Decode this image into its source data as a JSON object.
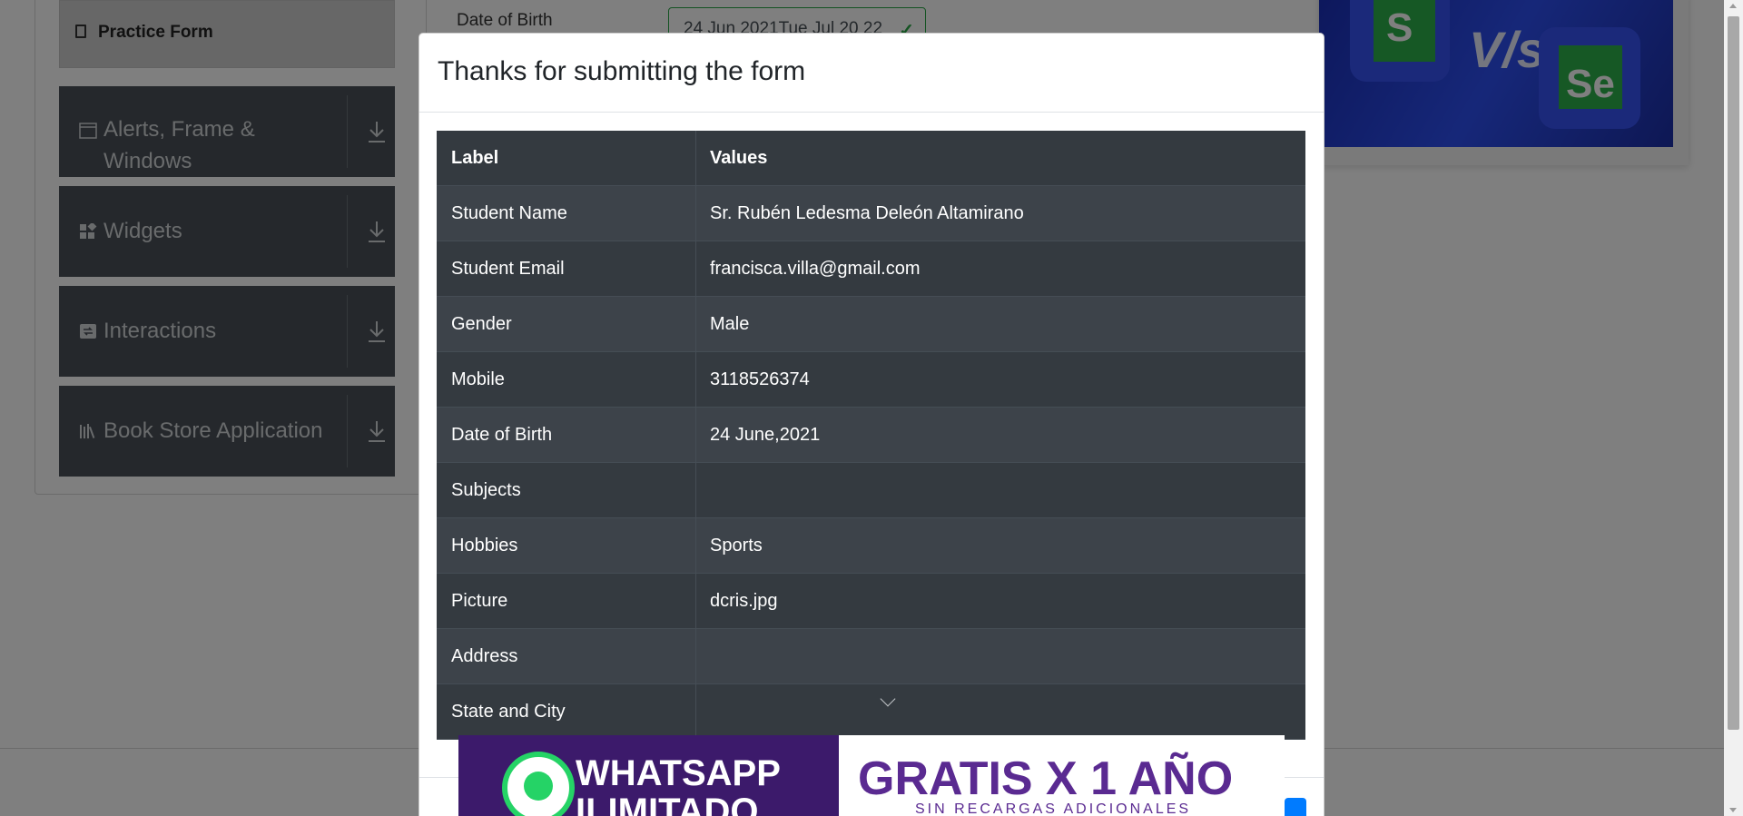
{
  "background": {
    "sidebar": {
      "active_item": "Practice Form",
      "groups": [
        {
          "label": "Alerts, Frame & Windows",
          "icon": "window-icon"
        },
        {
          "label": "Widgets",
          "icon": "widgets-icon"
        },
        {
          "label": "Interactions",
          "icon": "interactions-icon"
        },
        {
          "label": "Book Store Application",
          "icon": "books-icon"
        }
      ]
    },
    "form": {
      "dob_label": "Date of Birth",
      "dob_value": "24 Jun 2021Tue Jul 20 22"
    },
    "ad_right": {
      "tile_left": "S",
      "vs": "V/s",
      "tile_right": "Se"
    }
  },
  "modal": {
    "title": "Thanks for submitting the form",
    "header": {
      "label": "Label",
      "value": "Values"
    },
    "rows": [
      {
        "label": "Student Name",
        "value": "Sr. Rubén Ledesma Deleón Altamirano"
      },
      {
        "label": "Student Email",
        "value": "francisca.villa@gmail.com"
      },
      {
        "label": "Gender",
        "value": "Male"
      },
      {
        "label": "Mobile",
        "value": "3118526374"
      },
      {
        "label": "Date of Birth",
        "value": "24 June,2021"
      },
      {
        "label": "Subjects",
        "value": ""
      },
      {
        "label": "Hobbies",
        "value": "Sports"
      },
      {
        "label": "Picture",
        "value": "dcris.jpg"
      },
      {
        "label": "Address",
        "value": ""
      },
      {
        "label": "State and City",
        "value": ""
      }
    ]
  },
  "ad_bottom": {
    "line1": "WHATSAPP",
    "line2": "ILIMITADO",
    "gratis": "GRATIS X 1 AÑO",
    "sub": "SIN RECARGAS ADICIONALES"
  },
  "colors": {
    "table_bg": "#343a40",
    "table_row_alt": "#3d434a",
    "sidebar_group_bg": "#4a5158",
    "success": "#28a745",
    "primary": "#007bff",
    "ad_purple": "#5a2a91"
  }
}
